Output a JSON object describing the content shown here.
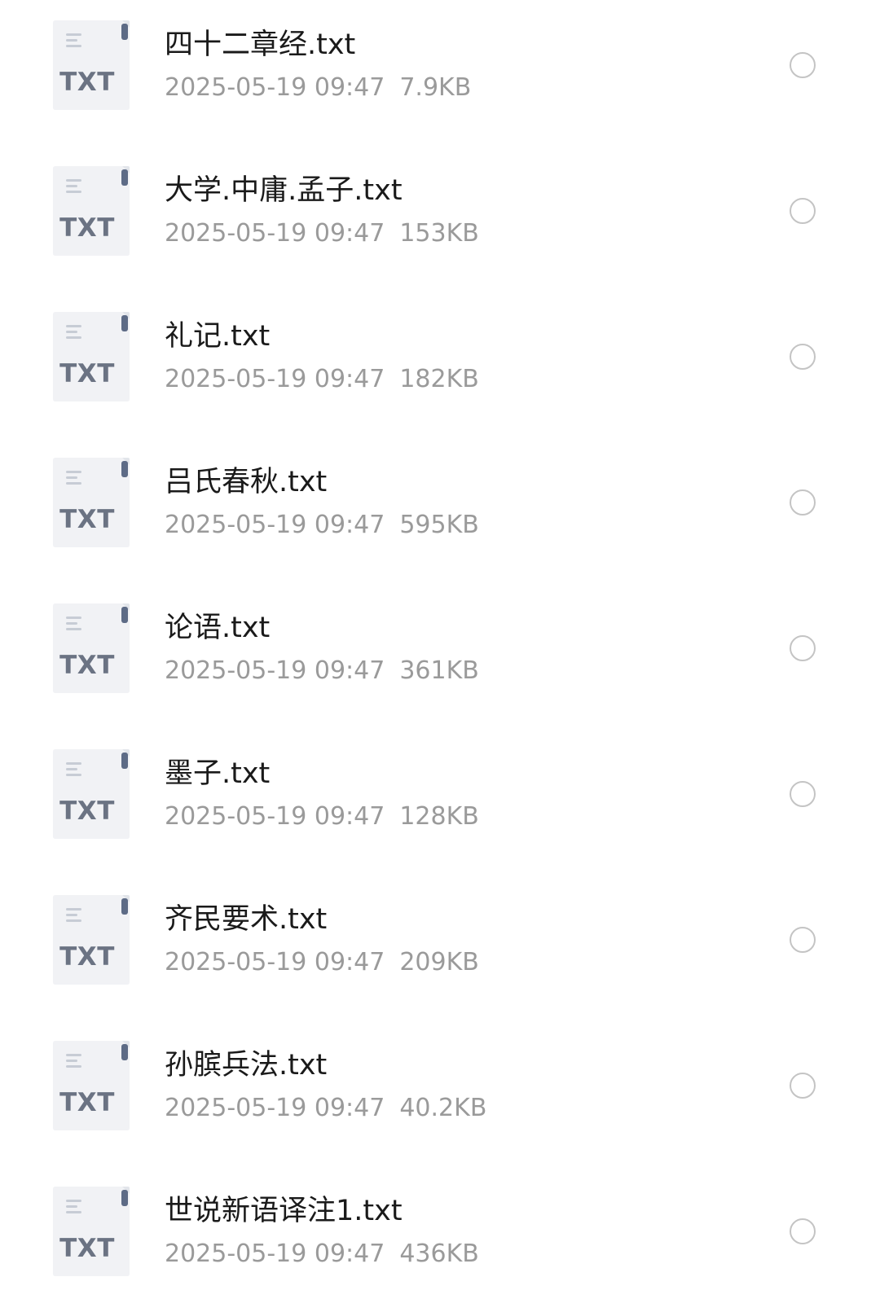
{
  "file_type_label": "TXT",
  "colors": {
    "file_name": "#1a1a1a",
    "meta_text": "#9a9a9a",
    "icon_label": "#6b7383",
    "radio_border": "#c4c4c4"
  },
  "icons": {
    "file": "txt-file-icon",
    "select": "radio-unchecked-icon"
  },
  "files": [
    {
      "name": "四十二章经.txt",
      "date": "2025-05-19 09:47",
      "size": "7.9KB"
    },
    {
      "name": "大学.中庸.孟子.txt",
      "date": "2025-05-19 09:47",
      "size": "153KB"
    },
    {
      "name": "礼记.txt",
      "date": "2025-05-19 09:47",
      "size": "182KB"
    },
    {
      "name": "吕氏春秋.txt",
      "date": "2025-05-19 09:47",
      "size": "595KB"
    },
    {
      "name": "论语.txt",
      "date": "2025-05-19 09:47",
      "size": "361KB"
    },
    {
      "name": "墨子.txt",
      "date": "2025-05-19 09:47",
      "size": "128KB"
    },
    {
      "name": "齐民要术.txt",
      "date": "2025-05-19 09:47",
      "size": "209KB"
    },
    {
      "name": "孙膑兵法.txt",
      "date": "2025-05-19 09:47",
      "size": "40.2KB"
    },
    {
      "name": "世说新语译注1.txt",
      "date": "2025-05-19 09:47",
      "size": "436KB"
    }
  ]
}
